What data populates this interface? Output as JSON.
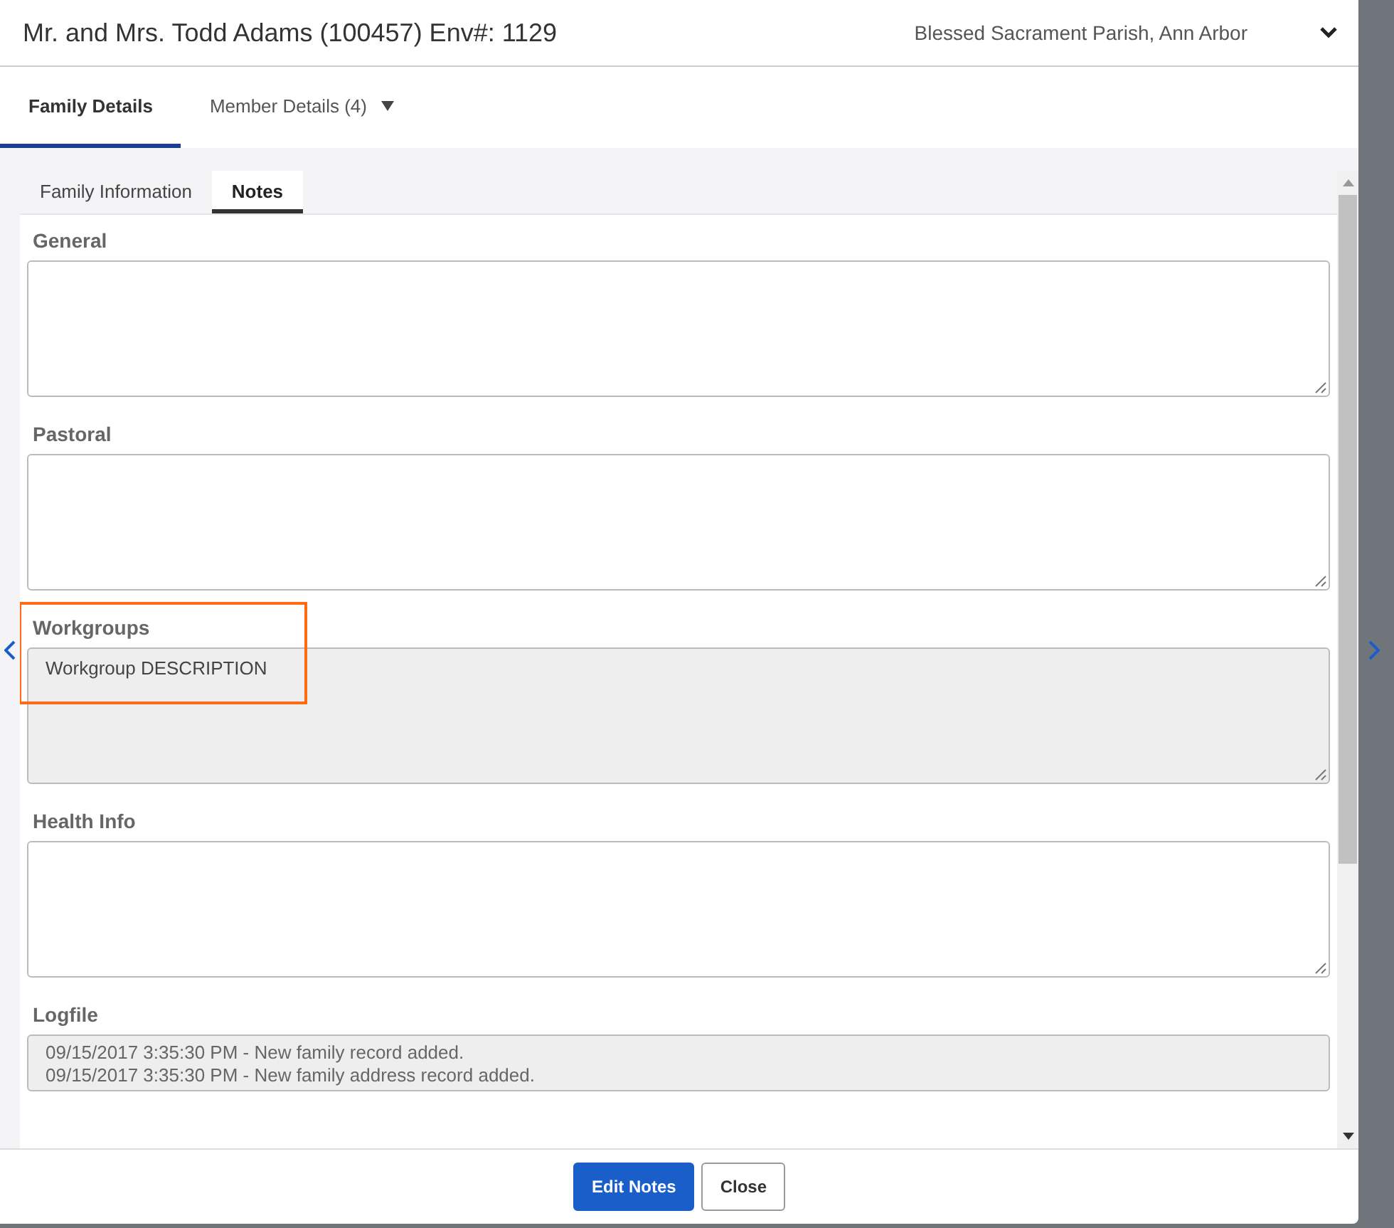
{
  "header": {
    "title": "Mr. and Mrs. Todd Adams (100457) Env#: 1129",
    "parish": "Blessed Sacrament Parish, Ann Arbor"
  },
  "main_tabs": [
    {
      "label": "Family Details",
      "selected": true,
      "dropdown": false
    },
    {
      "label": "Member Details (4)",
      "selected": false,
      "dropdown": true
    }
  ],
  "sub_tabs": [
    {
      "label": "Family Information",
      "selected": false
    },
    {
      "label": "Notes",
      "selected": true
    }
  ],
  "fields": [
    {
      "label": "General",
      "readonly": false,
      "highlighted": false
    },
    {
      "label": "Pastoral",
      "readonly": false,
      "highlighted": false
    },
    {
      "label": "Workgroups",
      "readonly": true,
      "highlighted": true,
      "lines": [
        "Workgroup DESCRIPTION"
      ]
    },
    {
      "label": "Health Info",
      "readonly": false,
      "highlighted": false
    },
    {
      "label": "Logfile",
      "readonly": true,
      "highlighted": false,
      "kind": "log",
      "lines": [
        "09/15/2017  3:35:30 PM - New family record added.",
        "09/15/2017  3:35:30 PM - New family address record added."
      ]
    }
  ],
  "buttons": [
    {
      "label": "Edit Notes",
      "primary": true
    },
    {
      "label": "Close",
      "primary": false
    }
  ]
}
